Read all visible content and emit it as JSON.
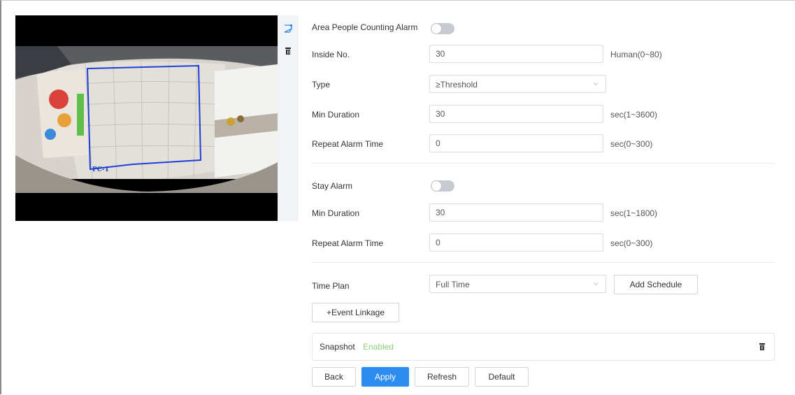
{
  "video": {
    "region_label": "PC-1",
    "region_color": "#1f3fd6",
    "tools": [
      {
        "icon": "draw-region-icon"
      },
      {
        "icon": "delete-icon"
      }
    ]
  },
  "area_alarm": {
    "label": "Area People Counting Alarm",
    "enabled": false
  },
  "inside_no": {
    "label": "Inside No.",
    "value": "30",
    "unit": "Human(0~80)"
  },
  "type": {
    "label": "Type",
    "value": "≥Threshold"
  },
  "min_duration_1": {
    "label": "Min Duration",
    "value": "30",
    "unit": "sec(1~3600)"
  },
  "repeat_alarm_1": {
    "label": "Repeat Alarm Time",
    "value": "0",
    "unit": "sec(0~300)"
  },
  "stay_alarm": {
    "label": "Stay Alarm",
    "enabled": false
  },
  "min_duration_2": {
    "label": "Min Duration",
    "value": "30",
    "unit": "sec(1~1800)"
  },
  "repeat_alarm_2": {
    "label": "Repeat Alarm Time",
    "value": "0",
    "unit": "sec(0~300)"
  },
  "time_plan": {
    "label": "Time Plan",
    "value": "Full Time",
    "add_schedule": "Add Schedule"
  },
  "event_linkage": {
    "button": "+Event Linkage",
    "item_name": "Snapshot",
    "item_state": "Enabled",
    "item_state_color": "#8fcf7a"
  },
  "footer": {
    "back": "Back",
    "apply": "Apply",
    "refresh": "Refresh",
    "default": "Default"
  },
  "colors": {
    "primary": "#2d8cf0",
    "toggle_off": "#c7cbd1"
  }
}
